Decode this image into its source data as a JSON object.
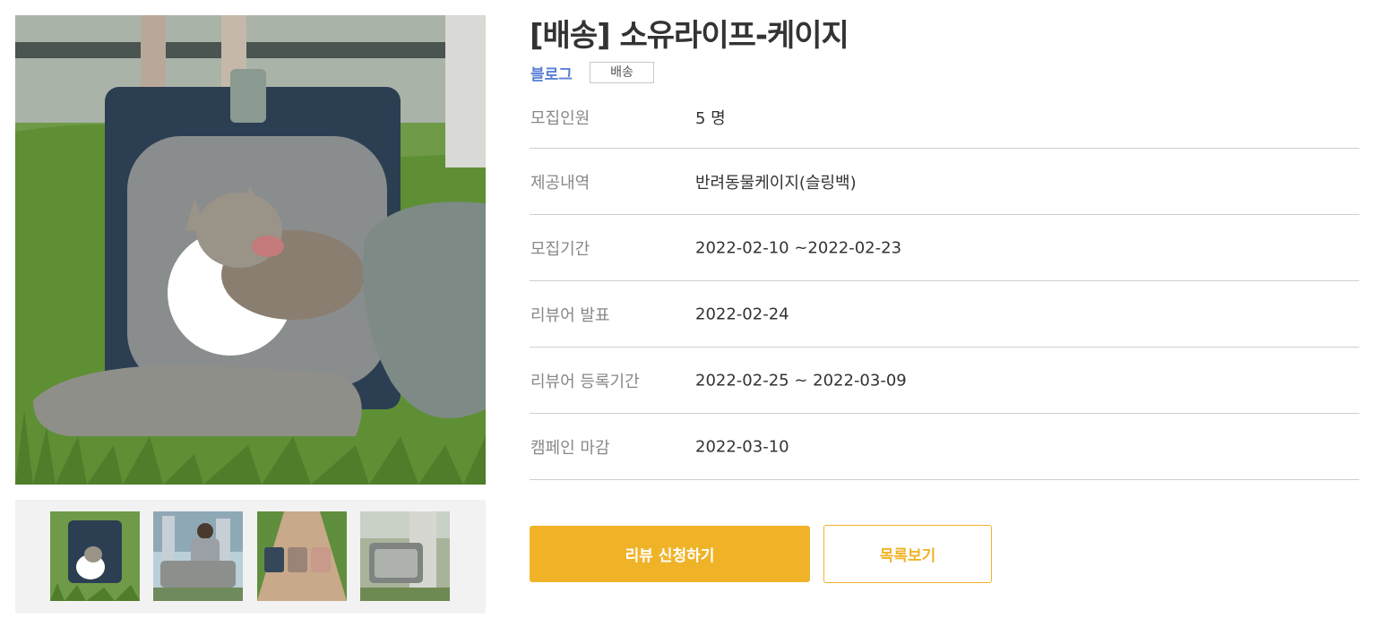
{
  "campaign": {
    "title": "[배송] 소유라이프-케이지",
    "channel": "블로그",
    "badge": "배송"
  },
  "images": {
    "main_alt": "고양이가 들어있는 반려동물 케이지",
    "thumbnails": [
      {
        "alt": "thumbnail-1"
      },
      {
        "alt": "thumbnail-2"
      },
      {
        "alt": "thumbnail-3"
      },
      {
        "alt": "thumbnail-4"
      }
    ]
  },
  "info": {
    "recruit_count": {
      "label": "모집인원",
      "value": "5 명"
    },
    "offer": {
      "label": "제공내역",
      "value": "반려동물케이지(슬링백)"
    },
    "recruit_period": {
      "label": "모집기간",
      "value": "2022-02-10 ~2022-02-23"
    },
    "reviewer_announce": {
      "label": "리뷰어 발표",
      "value": "2022-02-24"
    },
    "review_period": {
      "label": "리뷰어 등록기간",
      "value": "2022-02-25 ~ 2022-03-09"
    },
    "campaign_close": {
      "label": "캠페인 마감",
      "value": "2022-03-10"
    }
  },
  "actions": {
    "apply_label": "리뷰 신청하기",
    "list_label": "목록보기"
  },
  "colors": {
    "accent": "#f0b328",
    "channel": "#5b7fd6"
  }
}
